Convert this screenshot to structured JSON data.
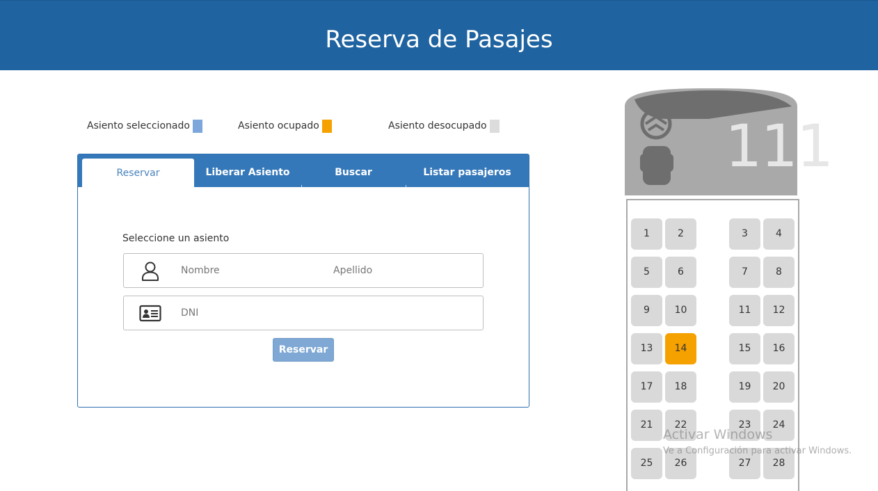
{
  "header": {
    "title": "Reserva de Pasajes"
  },
  "legend": {
    "selected": {
      "label": "Asiento seleccionado",
      "color": "#7da6dc"
    },
    "occupied": {
      "label": "Asiento ocupado",
      "color": "#f5a100"
    },
    "free": {
      "label": "Asiento desocupado",
      "color": "#dcdcdc"
    }
  },
  "tabs": [
    {
      "label": "Reservar",
      "active": true
    },
    {
      "label": "Liberar Asiento",
      "active": false
    },
    {
      "label": "Buscar",
      "active": false
    },
    {
      "label": "Listar pasajeros",
      "active": false
    }
  ],
  "form": {
    "seat_prompt": "Seleccione un asiento",
    "nombre_placeholder": "Nombre",
    "apellido_placeholder": "Apellido",
    "dni_placeholder": "DNI",
    "submit_label": "Reservar",
    "icons": {
      "person": "person-icon",
      "id_card": "id-card-icon"
    }
  },
  "bus": {
    "number": "111",
    "seats": [
      {
        "label": "1",
        "status": "free"
      },
      {
        "label": "2",
        "status": "free"
      },
      {
        "label": "3",
        "status": "free"
      },
      {
        "label": "4",
        "status": "free"
      },
      {
        "label": "5",
        "status": "free"
      },
      {
        "label": "6",
        "status": "free"
      },
      {
        "label": "7",
        "status": "free"
      },
      {
        "label": "8",
        "status": "free"
      },
      {
        "label": "9",
        "status": "free"
      },
      {
        "label": "10",
        "status": "free"
      },
      {
        "label": "11",
        "status": "free"
      },
      {
        "label": "12",
        "status": "free"
      },
      {
        "label": "13",
        "status": "free"
      },
      {
        "label": "14",
        "status": "occupied"
      },
      {
        "label": "15",
        "status": "free"
      },
      {
        "label": "16",
        "status": "free"
      },
      {
        "label": "17",
        "status": "free"
      },
      {
        "label": "18",
        "status": "free"
      },
      {
        "label": "19",
        "status": "free"
      },
      {
        "label": "20",
        "status": "free"
      },
      {
        "label": "21",
        "status": "free"
      },
      {
        "label": "22",
        "status": "free"
      },
      {
        "label": "23",
        "status": "free"
      },
      {
        "label": "24",
        "status": "free"
      },
      {
        "label": "25",
        "status": "free"
      },
      {
        "label": "26",
        "status": "free"
      },
      {
        "label": "27",
        "status": "free"
      },
      {
        "label": "28",
        "status": "free"
      }
    ]
  },
  "watermark": {
    "title": "Activar Windows",
    "subtitle": "Ve a Configuración para activar Windows."
  }
}
